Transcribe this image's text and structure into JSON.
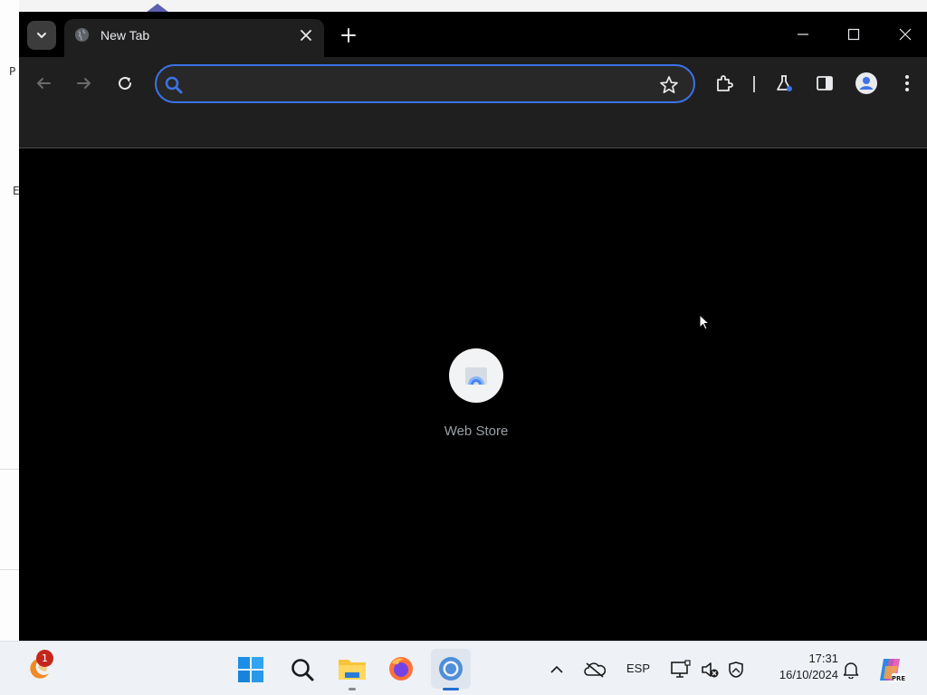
{
  "browser": {
    "tab_title": "New Tab",
    "omnibox": {
      "value": "",
      "placeholder": ""
    }
  },
  "new_tab_page": {
    "shortcuts": [
      {
        "label": "Web Store",
        "icon": "web-store-icon"
      }
    ]
  },
  "desktop_fragments": {
    "left_text_1": "P",
    "left_text_2": "E"
  },
  "taskbar": {
    "widgets_badge": "1",
    "language": "ESP",
    "time": "17:31",
    "date": "16/10/2024",
    "pinned": [
      "windows-start-icon",
      "search-icon",
      "file-explorer-icon",
      "firefox-icon",
      "chrome-icon"
    ],
    "tray": [
      "show-hidden-icons-chevron",
      "onedrive-icon",
      "language-indicator",
      "network-icon",
      "volume-muted-icon",
      "security-icon",
      "notifications-bell-icon",
      "copilot-icon"
    ]
  },
  "colors": {
    "accent_blue": "#3b73e8",
    "window_bg": "#000000",
    "toolbar_bg": "#1f1f1f",
    "taskbar_bg": "#eef1f6",
    "badge_red": "#c4261b"
  }
}
